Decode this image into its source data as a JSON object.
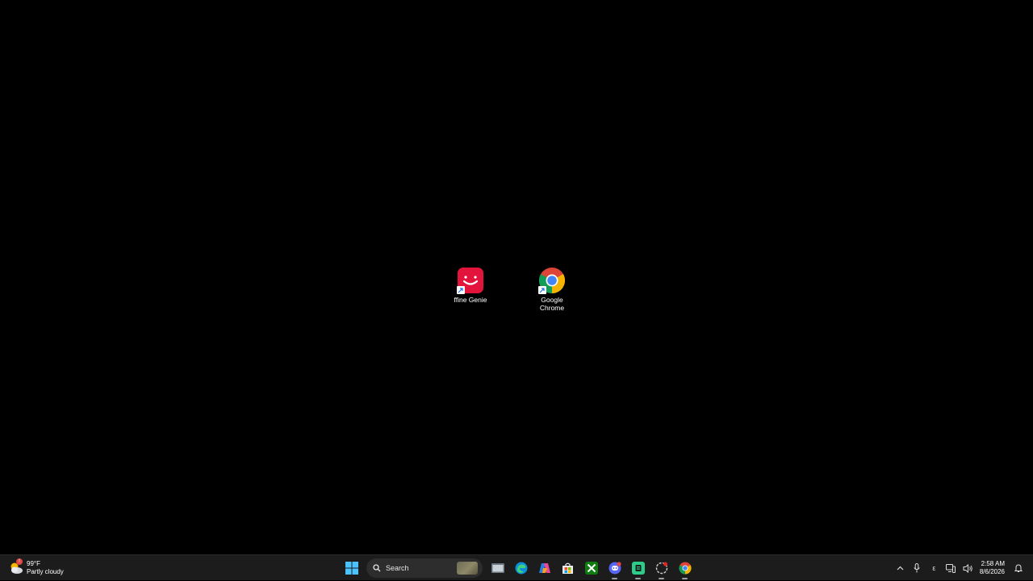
{
  "desktop": {
    "icons": [
      {
        "label": "ffine Genie",
        "icon": "fifine-genie-icon",
        "color": "#e2143c"
      },
      {
        "label": "Google Chrome",
        "icon": "chrome-icon"
      }
    ]
  },
  "taskbar": {
    "weather": {
      "temp": "99°F",
      "condition": "Partly cloudy",
      "icon": "partly-cloudy-icon"
    },
    "search": {
      "label": "Search"
    },
    "apps": [
      {
        "name": "start",
        "icon": "windows-start-icon"
      },
      {
        "name": "file-explorer",
        "icon": "file-explorer-icon"
      },
      {
        "name": "edge",
        "icon": "edge-icon"
      },
      {
        "name": "copilot",
        "icon": "copilot-icon"
      },
      {
        "name": "store",
        "icon": "microsoft-store-icon"
      },
      {
        "name": "xbox",
        "icon": "xbox-icon"
      },
      {
        "name": "discord",
        "icon": "discord-icon"
      },
      {
        "name": "green-app",
        "icon": "green-app-icon"
      },
      {
        "name": "recorder",
        "icon": "recorder-icon"
      },
      {
        "name": "chrome",
        "icon": "chrome-icon"
      }
    ],
    "tray": {
      "overflow_icon": "chevron-up-icon",
      "mic_icon": "microphone-icon",
      "language": "ε",
      "network_icon": "network-icon",
      "volume_icon": "volume-icon",
      "notification_icon": "notification-icon"
    },
    "clock": {
      "time": "2:58 AM",
      "date": "8/6/2026"
    }
  },
  "colors": {
    "taskbar_bg": "#1c1c1c",
    "desktop_bg": "#000000",
    "accent": "#4cc2ff"
  }
}
